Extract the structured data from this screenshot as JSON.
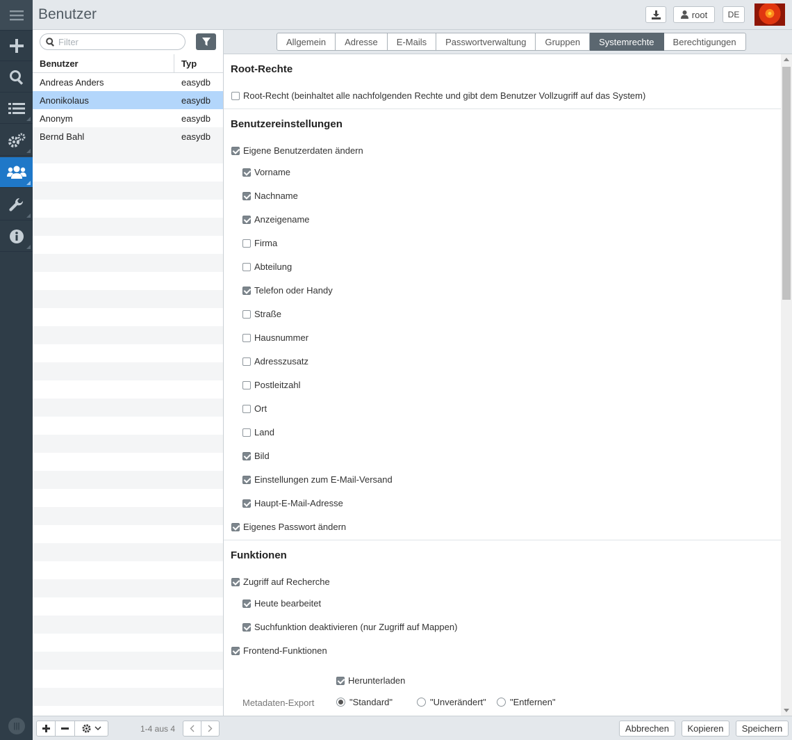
{
  "header": {
    "title": "Benutzer",
    "user_label": "root",
    "lang_label": "DE"
  },
  "nav": {
    "items": [
      "plus-icon",
      "search-icon",
      "list-icon",
      "gears-icon",
      "users-icon",
      "wrench-icon",
      "info-icon"
    ],
    "active": "users-icon"
  },
  "list": {
    "filter_placeholder": "Filter",
    "columns": [
      "Benutzer",
      "Typ"
    ],
    "rows": [
      {
        "name": "Andreas Anders",
        "type": "easydb"
      },
      {
        "name": "Anonikolaus",
        "type": "easydb"
      },
      {
        "name": "Anonym",
        "type": "easydb"
      },
      {
        "name": "Bernd Bahl",
        "type": "easydb"
      }
    ],
    "selected_index": 1,
    "pager": "1-4 aus 4"
  },
  "tabs": [
    "Allgemein",
    "Adresse",
    "E-Mails",
    "Passwortverwaltung",
    "Gruppen",
    "Systemrechte",
    "Berechtigungen"
  ],
  "active_tab": "Systemrechte",
  "sections": {
    "root": {
      "title": "Root-Rechte",
      "root_right": {
        "label": "Root-Recht (beinhaltet alle nachfolgenden Rechte und gibt dem Benutzer Vollzugriff auf das System)",
        "checked": false
      }
    },
    "user_settings": {
      "title": "Benutzereinstellungen",
      "own_data": {
        "label": "Eigene Benutzerdaten ändern",
        "checked": true
      },
      "fields": [
        {
          "label": "Vorname",
          "checked": true
        },
        {
          "label": "Nachname",
          "checked": true
        },
        {
          "label": "Anzeigename",
          "checked": true
        },
        {
          "label": "Firma",
          "checked": false
        },
        {
          "label": "Abteilung",
          "checked": false
        },
        {
          "label": "Telefon oder Handy",
          "checked": true
        },
        {
          "label": "Straße",
          "checked": false
        },
        {
          "label": "Hausnummer",
          "checked": false
        },
        {
          "label": "Adresszusatz",
          "checked": false
        },
        {
          "label": "Postleitzahl",
          "checked": false
        },
        {
          "label": "Ort",
          "checked": false
        },
        {
          "label": "Land",
          "checked": false
        },
        {
          "label": "Bild",
          "checked": true
        },
        {
          "label": "Einstellungen zum E-Mail-Versand",
          "checked": true
        },
        {
          "label": "Haupt-E-Mail-Adresse",
          "checked": true
        }
      ],
      "own_password": {
        "label": "Eigenes Passwort ändern",
        "checked": true
      }
    },
    "functions": {
      "title": "Funktionen",
      "research": {
        "label": "Zugriff auf Recherche",
        "checked": true
      },
      "research_sub": [
        {
          "label": "Heute bearbeitet",
          "checked": true
        },
        {
          "label": "Suchfunktion deaktivieren (nur Zugriff auf Mappen)",
          "checked": true
        }
      ],
      "frontend": {
        "label": "Frontend-Funktionen",
        "checked": true
      },
      "download": {
        "label": "Herunterladen",
        "checked": true
      },
      "metadata_export": {
        "label": "Metadaten-Export",
        "options": [
          "\"Standard\"",
          "\"Unverändert\"",
          "\"Entfernen\""
        ],
        "selected": 0
      }
    }
  },
  "footer": {
    "cancel": "Abbrechen",
    "copy": "Kopieren",
    "save": "Speichern"
  },
  "colors": {
    "accent": "#1f78c8",
    "selection": "#b3d6fb",
    "nav_bg": "#2f3d48",
    "tab_active": "#5b6770"
  }
}
